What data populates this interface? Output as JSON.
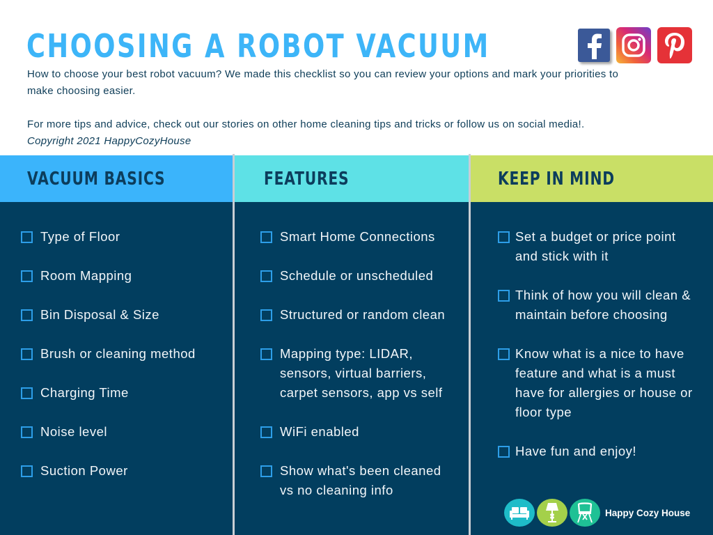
{
  "header": {
    "title": "CHOOSING A ROBOT VACUUM",
    "intro_line1": "How to choose your best robot vacuum? We made this checklist so you can review your options and mark your priorities to",
    "intro_line2": "make choosing easier.",
    "intro_line3": "For more tips and advice, check out our stories on other home cleaning tips and tricks or follow us on social media!.",
    "copyright": "Copyright 2021 HappyCozyHouse"
  },
  "social": [
    {
      "name": "facebook-icon",
      "color": "#3b5998"
    },
    {
      "name": "instagram-icon",
      "color": "#d62976"
    },
    {
      "name": "pinterest-icon",
      "color": "#e53238"
    }
  ],
  "columns": [
    {
      "heading": "VACUUM BASICS",
      "color": "#3bb4fb",
      "items": [
        "Type of Floor",
        "Room Mapping",
        "Bin Disposal & Size",
        "Brush or cleaning method",
        "Charging Time",
        "Noise level",
        "Suction Power"
      ]
    },
    {
      "heading": "FEATURES",
      "color": "#5ee1e6",
      "items": [
        "Smart Home Connections",
        "Schedule or unscheduled",
        "Structured or random clean",
        "Mapping type: LIDAR, sensors, virtual barriers, carpet sensors, app vs self",
        "WiFi enabled",
        "Show what's been cleaned vs no cleaning info"
      ]
    },
    {
      "heading": "KEEP IN MIND",
      "color": "#c9df66",
      "items": [
        "Set a budget or price point and stick with it",
        "Think of how you will clean & maintain before choosing",
        "Know what is a nice to have feature and what is a must have for allergies or house or floor type",
        "Have fun and enjoy!"
      ]
    }
  ],
  "colors": {
    "title": "#3db5f8",
    "body_bg": "#023e5f",
    "checkbox": "#2d9ee8",
    "heading_text": "#0c3d5c"
  },
  "brand": {
    "name": "Happy Cozy House",
    "icons": [
      "sofa-icon",
      "lamp-icon",
      "chair-icon"
    ]
  }
}
